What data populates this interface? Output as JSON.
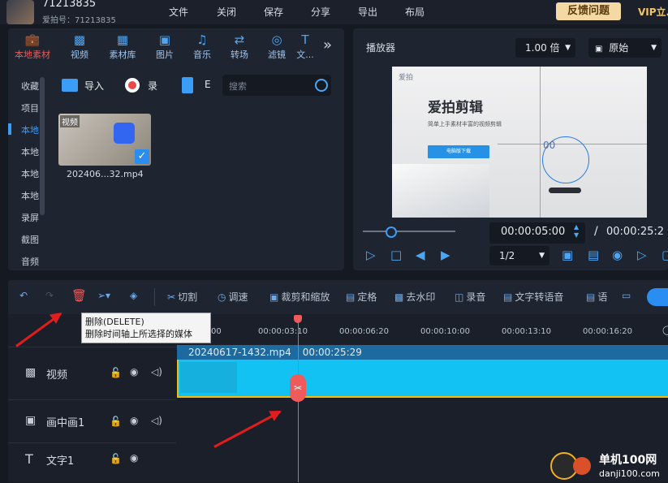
{
  "user": {
    "name": "71213835",
    "id_label": "爱拍号：71213835"
  },
  "menu": [
    "文件",
    "关闭",
    "保存",
    "分享",
    "导出",
    "布局"
  ],
  "feedback_label": "反馈问题",
  "vip_label": "VIP立...",
  "media": {
    "tabs": [
      {
        "label": "本地素材",
        "icon": "briefcase-icon"
      },
      {
        "label": "视频",
        "icon": "film-icon"
      },
      {
        "label": "素材库",
        "icon": "library-icon"
      },
      {
        "label": "图片",
        "icon": "image-icon"
      },
      {
        "label": "音乐",
        "icon": "music-icon"
      },
      {
        "label": "转场",
        "icon": "transition-icon"
      },
      {
        "label": "滤镜",
        "icon": "filter-icon"
      },
      {
        "label": "文...",
        "icon": "text-icon"
      }
    ],
    "sidebar": [
      "收藏",
      "项目",
      "本地",
      "本地",
      "本地",
      "本地",
      "录屏",
      "截图",
      "音频"
    ],
    "import_label": "导入",
    "record_label": "录",
    "doc_label": "E",
    "search_placeholder": "搜索",
    "thumb_tag": "视频",
    "thumb_name": "202406...32.mp4"
  },
  "player": {
    "title": "播放器",
    "speed": "1.00 倍",
    "ratio": "原始",
    "preview_title": "爱拍剪辑",
    "preview_sub": "简单上手素材丰富的视频剪辑",
    "preview_btn": "电脑版下载",
    "preview_badge": "爱拍",
    "preview_num": "00",
    "current_time": "00:00:05:00",
    "total_time": "00:00:25:2",
    "quality": "1/2",
    "progress": 0.2
  },
  "toolbar": {
    "tools": [
      "切割",
      "调速",
      "裁剪和缩放",
      "定格",
      "去水印",
      "录音",
      "文字转语音",
      "语"
    ]
  },
  "tooltip": {
    "line1": "删除(DELETE)",
    "line2": "删除时间轴上所选择的媒体"
  },
  "ruler": [
    "00",
    "00:00:03:10",
    "00:00:06:20",
    "00:00:10:00",
    "00:00:13:10",
    "00:00:16:20"
  ],
  "clip": {
    "name": "20240617-1432.mp4",
    "duration": "00:00:25:29"
  },
  "tracks": [
    "视频",
    "画中画1",
    "文字1"
  ],
  "watermark": {
    "title": "单机100网",
    "url": "danji100.com"
  }
}
